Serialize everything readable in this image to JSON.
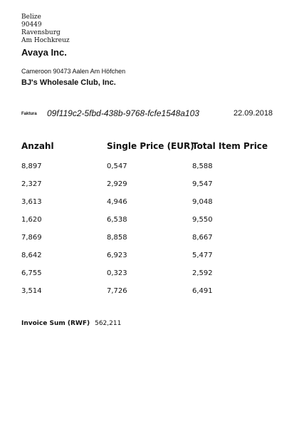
{
  "sender": {
    "lines": [
      "Belize",
      "90449",
      "Ravensburg",
      "Am Hochkreuz"
    ]
  },
  "company": "Avaya Inc.",
  "address": "Cameroon 90473 Aalen Am Höfchen",
  "recipient": "BJ's Wholesale Club, Inc.",
  "invoice": {
    "label": "Faktura",
    "id": "09f119c2-5fbd-438b-9768-fcfe1548a103",
    "date": "22.09.2018"
  },
  "table": {
    "headers": [
      "Anzahl",
      "Single Price (EUR)",
      "Total Item Price"
    ],
    "rows": [
      [
        "8,897",
        "0,547",
        "8,588"
      ],
      [
        "2,327",
        "2,929",
        "9,547"
      ],
      [
        "3,613",
        "4,946",
        "9,048"
      ],
      [
        "1,620",
        "6,538",
        "9,550"
      ],
      [
        "7,869",
        "8,858",
        "8,667"
      ],
      [
        "8,642",
        "6,923",
        "5,477"
      ],
      [
        "6,755",
        "0,323",
        "2,592"
      ],
      [
        "3,514",
        "7,726",
        "6,491"
      ]
    ]
  },
  "sum": {
    "label": "Invoice Sum (RWF)",
    "value": "562,211"
  }
}
